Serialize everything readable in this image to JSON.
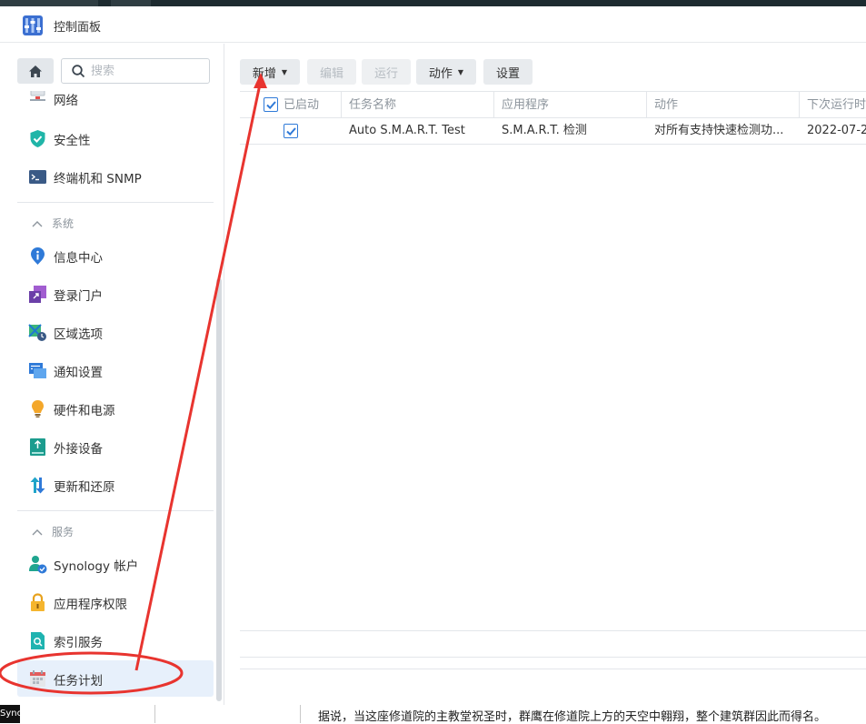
{
  "window": {
    "title": "控制面板"
  },
  "search": {
    "placeholder": "搜索"
  },
  "sidebar": {
    "items_top": [
      {
        "label": "网络",
        "icon": "network-icon"
      },
      {
        "label": "安全性",
        "icon": "shield-icon"
      },
      {
        "label": "终端机和 SNMP",
        "icon": "terminal-icon"
      }
    ],
    "section_system": "系统",
    "items_system": [
      {
        "label": "信息中心",
        "icon": "info-icon"
      },
      {
        "label": "登录门户",
        "icon": "login-portal-icon"
      },
      {
        "label": "区域选项",
        "icon": "region-icon"
      },
      {
        "label": "通知设置",
        "icon": "notification-icon"
      },
      {
        "label": "硬件和电源",
        "icon": "bulb-icon"
      },
      {
        "label": "外接设备",
        "icon": "external-device-icon"
      },
      {
        "label": "更新和还原",
        "icon": "update-icon"
      }
    ],
    "section_services": "服务",
    "items_services": [
      {
        "label": "Synology 帐户",
        "icon": "account-icon"
      },
      {
        "label": "应用程序权限",
        "icon": "lock-icon"
      },
      {
        "label": "索引服务",
        "icon": "index-icon"
      },
      {
        "label": "任务计划",
        "icon": "calendar-icon",
        "active": true
      }
    ]
  },
  "toolbar": {
    "add": "新增",
    "edit": "编辑",
    "run": "运行",
    "action": "动作",
    "settings": "设置"
  },
  "table": {
    "columns": [
      "已启动",
      "任务名称",
      "应用程序",
      "动作",
      "下次运行时"
    ],
    "rows": [
      {
        "enabled": true,
        "name": "Auto S.M.A.R.T. Test",
        "app": "S.M.A.R.T. 检测",
        "action": "对所有支持快速检测功...",
        "next_run": "2022-07-2"
      }
    ]
  },
  "bottom": {
    "tab": "Sync",
    "caption": "据说，当这座修道院的主教堂祝圣时，群鹰在修道院上方的天空中翱翔，整个建筑群因此而得名。"
  },
  "colors": {
    "accent": "#2f7ad8",
    "annotation": "#e8342f",
    "active_bg": "#e7f0fb"
  }
}
